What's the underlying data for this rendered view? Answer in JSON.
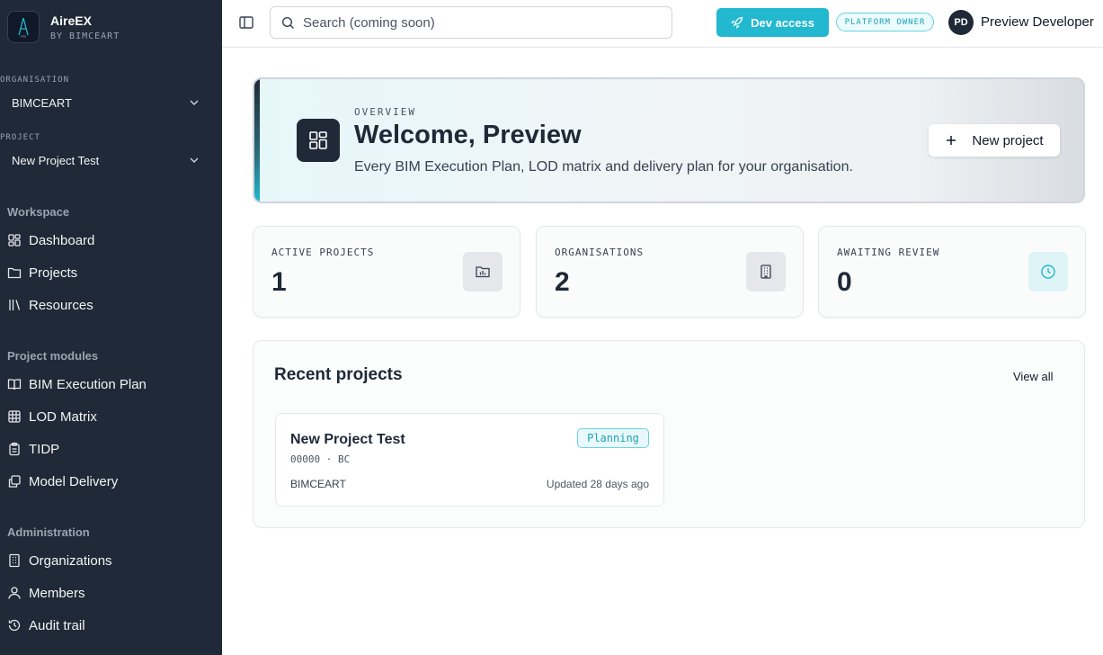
{
  "brand": {
    "name": "AireEX",
    "sub": "BY BIMCEART"
  },
  "organisation": {
    "label": "ORGANISATION",
    "value": "BIMCEART"
  },
  "project": {
    "label": "PROJECT",
    "value": "New Project Test"
  },
  "sidebar": {
    "workspace_title": "Workspace",
    "workspace": [
      {
        "label": "Dashboard",
        "icon": "dashboard-icon"
      },
      {
        "label": "Projects",
        "icon": "folder-icon"
      },
      {
        "label": "Resources",
        "icon": "library-icon"
      }
    ],
    "modules_title": "Project modules",
    "modules": [
      {
        "label": "BIM Execution Plan",
        "icon": "book-icon"
      },
      {
        "label": "LOD Matrix",
        "icon": "grid-icon"
      },
      {
        "label": "TIDP",
        "icon": "clipboard-icon"
      },
      {
        "label": "Model Delivery",
        "icon": "delivery-icon"
      }
    ],
    "admin_title": "Administration",
    "admin": [
      {
        "label": "Organizations",
        "icon": "building-icon"
      },
      {
        "label": "Members",
        "icon": "user-icon"
      },
      {
        "label": "Audit trail",
        "icon": "history-icon"
      }
    ]
  },
  "topbar": {
    "search_placeholder": "Search (coming soon)",
    "dev_access": "Dev access",
    "owner_badge": "PLATFORM OWNER",
    "avatar_initials": "PD",
    "user_name": "Preview Developer"
  },
  "hero": {
    "kicker": "OVERVIEW",
    "title": "Welcome, Preview",
    "description": "Every BIM Execution Plan, LOD matrix and delivery plan for your organisation.",
    "new_project": "New project"
  },
  "stats": [
    {
      "label": "ACTIVE PROJECTS",
      "value": "1",
      "icon": "folder-chart-icon"
    },
    {
      "label": "ORGANISATIONS",
      "value": "2",
      "icon": "building-icon"
    },
    {
      "label": "AWAITING REVIEW",
      "value": "0",
      "icon": "clock-icon"
    }
  ],
  "recent": {
    "title": "Recent projects",
    "view_all": "View all",
    "projects": [
      {
        "name": "New Project Test",
        "code": "00000 · BC",
        "status": "Planning",
        "org": "BIMCEART",
        "updated": "Updated 28 days ago"
      }
    ]
  },
  "colors": {
    "sidebar": "#1f2937",
    "accent": "#22b8cf",
    "accent_light": "#e9f9fb"
  }
}
